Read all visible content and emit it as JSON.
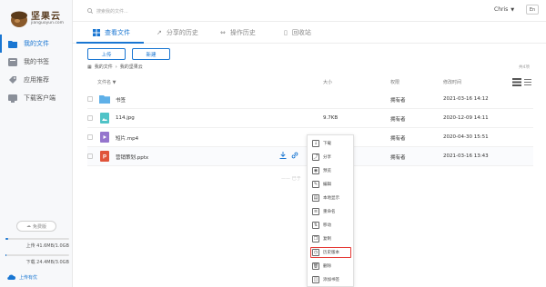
{
  "brand": {
    "name": "坚果云",
    "url": "jianguoyun.com"
  },
  "sidebar": {
    "items": [
      {
        "label": "我的文件",
        "icon": "folder-icon",
        "active": true
      },
      {
        "label": "我的书签",
        "icon": "bookmark-icon",
        "active": false
      },
      {
        "label": "应用推荐",
        "icon": "tag-icon",
        "active": false
      },
      {
        "label": "下载客户端",
        "icon": "monitor-icon",
        "active": false
      }
    ],
    "plan_label": "免费版",
    "upload_quota": "上传 41.6MB/1.0GB",
    "upload_fraction": 0.04,
    "download_quota": "下载 24.4MB/3.0GB",
    "download_fraction": 0.01,
    "upgrade_label": "上传有优"
  },
  "header": {
    "search_placeholder": "搜索我的文件...",
    "user": "Chris",
    "lang": "En"
  },
  "tabs": [
    {
      "label": "查看文件",
      "icon": "grid-icon",
      "active": true
    },
    {
      "label": "分享的历史",
      "icon": "share-arrow-icon",
      "active": false
    },
    {
      "label": "操作历史",
      "icon": "history-icon",
      "active": false
    },
    {
      "label": "回收站",
      "icon": "trash-icon",
      "active": false
    }
  ],
  "toolbar": {
    "upload": "上传",
    "new": "新建"
  },
  "breadcrumb": [
    "我的文件",
    "我的坚果云"
  ],
  "file_count": "共4项",
  "table": {
    "columns": [
      "文件名 ▼",
      "大小",
      "权限",
      "修改时间"
    ],
    "rows": [
      {
        "name": "书签",
        "type": "folder",
        "size": "",
        "perm": "拥有者",
        "date": "2021-03-16 14:12"
      },
      {
        "name": "114.jpg",
        "type": "image",
        "size": "9.7KB",
        "perm": "拥有者",
        "date": "2020-12-09 14:11"
      },
      {
        "name": "短片.mp4",
        "type": "video",
        "size": "",
        "perm": "拥有者",
        "date": "2020-04-30 15:51"
      },
      {
        "name": "营销策划.pptx",
        "type": "ppt",
        "size": "",
        "perm": "拥有者",
        "date": "2021-03-16 13:43"
      }
    ]
  },
  "hint_text": "—— 已于",
  "context_menu": [
    {
      "label": "下载",
      "glyph": "↓",
      "icon": "download-icon"
    },
    {
      "label": "分享",
      "glyph": "⤴",
      "icon": "share-icon"
    },
    {
      "label": "预览",
      "glyph": "◉",
      "icon": "preview-icon"
    },
    {
      "label": "编辑",
      "glyph": "✎",
      "icon": "edit-icon"
    },
    {
      "label": "本地显示",
      "glyph": "▤",
      "icon": "local-icon"
    },
    {
      "label": "重命名",
      "glyph": "≡",
      "icon": "rename-icon"
    },
    {
      "label": "移动",
      "glyph": "⇅",
      "icon": "move-icon"
    },
    {
      "label": "复制",
      "glyph": "❐",
      "icon": "copy-icon"
    },
    {
      "label": "历史版本",
      "glyph": "◷",
      "icon": "history-version-icon",
      "highlight": true
    },
    {
      "label": "删除",
      "glyph": "🗑",
      "icon": "delete-icon"
    },
    {
      "label": "添加书签",
      "glyph": "◫",
      "icon": "add-bookmark-icon"
    }
  ],
  "colors": {
    "accent": "#1976d2",
    "highlight": "#e53935"
  }
}
